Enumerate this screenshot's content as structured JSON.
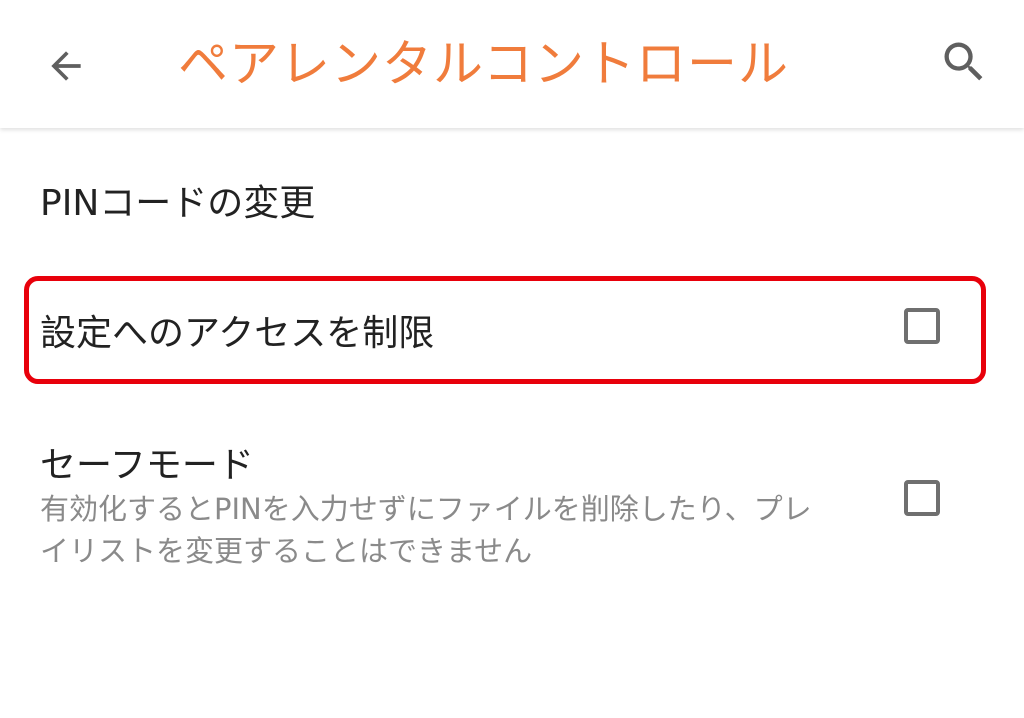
{
  "app_bar": {
    "title": "ペアレンタルコントロール",
    "title_color": "#f07c3c",
    "back_icon": "arrow-left-icon",
    "search_icon": "search-icon"
  },
  "items": [
    {
      "label": "PINコードの変更"
    },
    {
      "label": "設定へのアクセスを制限",
      "checked": false,
      "highlight_color": "#e8000b"
    },
    {
      "label": "セーフモード",
      "summary": "有効化するとPINを入力せずにファイルを削除したり、プレイリストを変更することはできません",
      "checked": false
    }
  ]
}
